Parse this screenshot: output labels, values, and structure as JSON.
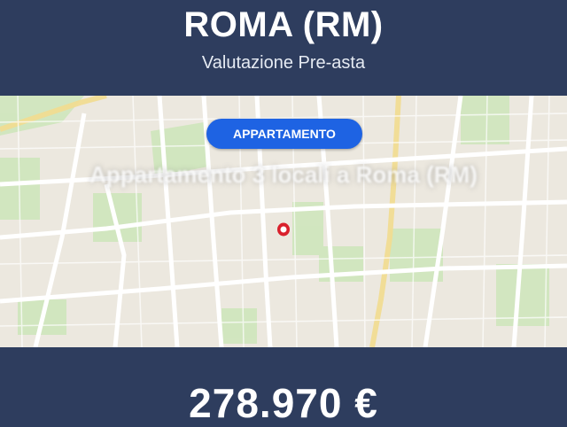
{
  "header": {
    "title": "ROMA (RM)",
    "subtitle": "Valutazione Pre-asta"
  },
  "map": {
    "badge": "APPARTAMENTO",
    "caption": "Appartamento 3 locali a Roma (RM)",
    "marker_icon": "map-pin-icon"
  },
  "footer": {
    "price": "278.970 €"
  },
  "colors": {
    "header_bg": "#2e3d5e",
    "badge_bg": "#1e63e3",
    "marker": "#d9202c",
    "map_park": "#c8e3b4"
  }
}
